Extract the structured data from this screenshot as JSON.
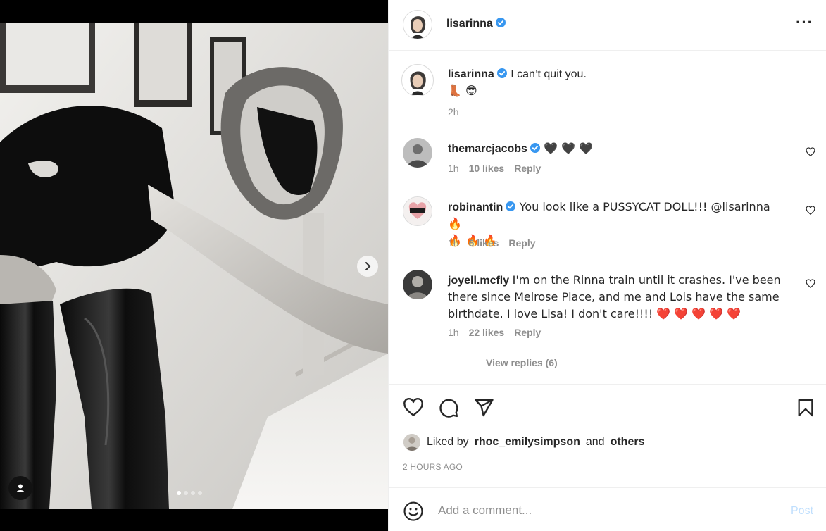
{
  "post": {
    "username": "lisarinna",
    "caption": "I can’t quit you.",
    "caption_emojis": "👢 😎",
    "caption_time": "2h",
    "more_icon": "more-horizontal-icon"
  },
  "comments": [
    {
      "username": "themarcjacobs",
      "text": "🖤 🖤 🖤",
      "time": "1h",
      "likes": "10 likes",
      "reply": "Reply"
    },
    {
      "username": "robinantin",
      "text": "You look like a PUSSYCAT DOLL!!! @lisarinna 🔥",
      "text2": "🔥 🔥 🔥",
      "time": "1h",
      "likes": "6 likes",
      "reply": "Reply"
    },
    {
      "username": "joyell.mcfly",
      "text": "I'm on the Rinna train until it crashes. I've been there since Melrose Place, and me and Lois have the same birthdate. I love Lisa! I don't care!!!! ❤️ ❤️ ❤️ ❤️ ❤️",
      "time": "1h",
      "likes": "22 likes",
      "reply": "Reply"
    }
  ],
  "view_replies": "View replies (6)",
  "liked_by": {
    "prefix": "Liked by",
    "user": "rhoc_emilysimpson",
    "and": "and",
    "others": "others"
  },
  "timestamp": "2 HOURS AGO",
  "add_comment": {
    "placeholder": "Add a comment...",
    "post_label": "Post"
  },
  "carousel": {
    "count": 4,
    "active": 1
  },
  "colors": {
    "verified": "#3897f0",
    "muted": "#8e8e8e",
    "post_disabled": "#c0dffd",
    "heart": "#ed4956"
  }
}
